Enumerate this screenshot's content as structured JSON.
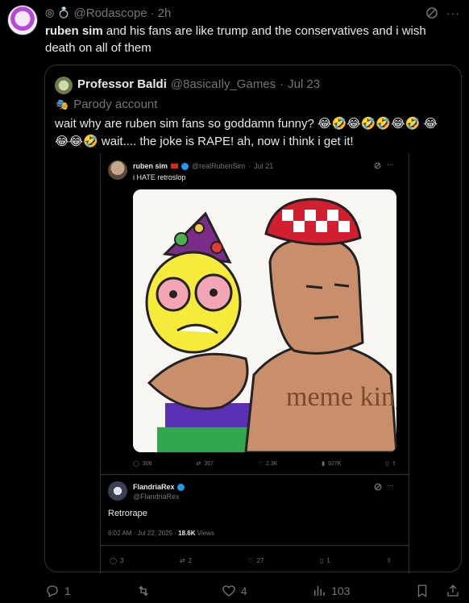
{
  "post": {
    "handle": "@Rodascope",
    "time": "2h",
    "badges": [
      "grok-icon",
      "ring-icon"
    ],
    "text_bold": "ruben sim",
    "text_rest": " and his fans are like trump and the conservatives and i wish death on all of them"
  },
  "quote": {
    "name": "Professor Baldi",
    "handle": "@8asicaIly_Games",
    "date": "Jul 23",
    "parody": "Parody account",
    "text": "wait why are ruben sim fans so goddamn funny? 😂🤣😂🤣🤣😂🤣 😂😂😂🤣 wait.... the joke is RAPE! ah, now i think i get it!"
  },
  "inner": {
    "name": "ruben sim",
    "handle": "@realRubenSim",
    "date": "Jul 21",
    "text": "i HATE retroslop",
    "image_text": "meme king",
    "stats": {
      "replies": "306",
      "reposts": "367",
      "likes": "2.3K",
      "views": "927K"
    }
  },
  "reply": {
    "name": "FlandriaRex",
    "handle": "@FlandriaRex",
    "text": "Retrorape",
    "meta_time": "6:02 AM · Jul 22, 2025 · ",
    "meta_views": "18.6K",
    "meta_views_label": " Views",
    "stats": {
      "replies": "3",
      "reposts": "2",
      "likes": "27",
      "views": "1"
    }
  },
  "actions": {
    "replies": "1",
    "reposts": "",
    "likes": "4",
    "views": "103"
  },
  "colors": {
    "accent": "#1d9bf0",
    "bg": "#000000",
    "border": "#2f3336",
    "muted": "#71767b"
  }
}
